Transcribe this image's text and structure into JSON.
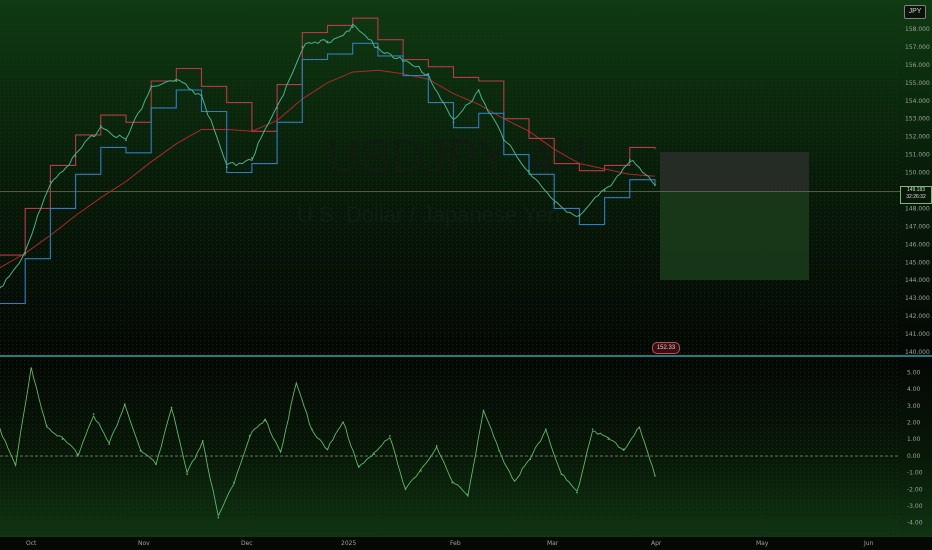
{
  "watermark": {
    "symbol": "USDJPY, 4H",
    "description": "U.S. Dollar / Japanese Yen"
  },
  "currency_badge": "JPY",
  "price_label": {
    "price": "149.183",
    "timer": "32:26:32"
  },
  "countdown_badge": "152.33",
  "colors": {
    "price": "#4fae8e",
    "resistance": "#b83a4a",
    "support": "#2f7ec0",
    "moving_average": "#a82a2a",
    "oscillator": "#63b569",
    "divider": "#2aa6a6",
    "profit_zone": "#1b3c1b",
    "risk_zone": "#2a2f2a"
  },
  "chart_data": [
    {
      "type": "line",
      "name": "price-pane",
      "yticks": [
        "158.000",
        "157.000",
        "156.000",
        "155.000",
        "154.000",
        "153.000",
        "152.000",
        "151.000",
        "150.000",
        "149.000",
        "148.000",
        "147.000",
        "146.000",
        "145.000",
        "144.000",
        "143.000",
        "142.000",
        "141.000",
        "140.000"
      ],
      "ylim": [
        140,
        158.5
      ],
      "xlabels": [
        "Oct",
        "Nov",
        "Dec",
        "2025",
        "Feb",
        "Mar",
        "Apr",
        "May",
        "Jun"
      ],
      "x": [
        "Oct 1",
        "Oct 8",
        "Oct 15",
        "Oct 22",
        "Oct 29",
        "Nov 5",
        "Nov 12",
        "Nov 19",
        "Nov 26",
        "Dec 3",
        "Dec 10",
        "Dec 17",
        "Dec 24",
        "Dec 31",
        "Jan 7",
        "Jan 14",
        "Jan 21",
        "Jan 28",
        "Feb 4",
        "Feb 11",
        "Feb 18",
        "Feb 25",
        "Mar 4",
        "Mar 11",
        "Mar 18",
        "Mar 25",
        "Apr 1"
      ],
      "series": [
        {
          "values": [
            143.6,
            145.5,
            149.5,
            150.9,
            152.6,
            151.8,
            154.8,
            155.1,
            154.3,
            150.3,
            150.8,
            153.6,
            157.0,
            157.3,
            158.1,
            157.0,
            156.2,
            155.5,
            152.8,
            154.6,
            151.8,
            150.1,
            148.3,
            147.6,
            149.0,
            150.7,
            149.3
          ]
        },
        {
          "values": [
            145.4,
            148.0,
            150.4,
            152.1,
            153.2,
            152.8,
            155.1,
            155.8,
            154.8,
            153.9,
            152.3,
            154.9,
            157.8,
            158.2,
            158.6,
            157.4,
            156.3,
            155.9,
            155.3,
            155.1,
            153.0,
            151.9,
            150.5,
            150.1,
            150.4,
            151.4,
            151.3
          ]
        },
        {
          "values": [
            142.7,
            145.2,
            148.0,
            149.9,
            151.4,
            151.1,
            153.6,
            154.6,
            153.4,
            150.0,
            150.5,
            152.8,
            156.3,
            156.6,
            157.2,
            156.5,
            155.4,
            153.9,
            152.5,
            153.3,
            151.0,
            149.9,
            148.0,
            147.1,
            148.6,
            149.6,
            149.3
          ]
        },
        {
          "values": [
            144.7,
            145.5,
            146.5,
            147.6,
            148.6,
            149.5,
            150.6,
            151.6,
            152.4,
            152.4,
            152.3,
            152.9,
            154.1,
            155.0,
            155.6,
            155.7,
            155.5,
            155.2,
            154.4,
            153.8,
            153.0,
            152.3,
            151.3,
            150.5,
            150.2,
            149.9,
            149.8
          ]
        }
      ]
    },
    {
      "type": "line",
      "name": "oscillator-pane",
      "yticks": [
        "5.00",
        "4.00",
        "3.00",
        "2.00",
        "1.00",
        "0.00",
        "-1.00",
        "-2.00",
        "-3.00",
        "-4.00"
      ],
      "ylim": [
        -4.5,
        5.5
      ],
      "series": [
        {
          "values": [
            1.6,
            -0.5,
            5.2,
            1.8,
            1.0,
            0.1,
            2.5,
            0.7,
            3.1,
            0.3,
            -0.5,
            2.9,
            -1.1,
            0.9,
            -3.7,
            -1.6,
            1.2,
            2.1,
            0.3,
            4.3,
            1.6,
            0.4,
            2.0,
            -0.6,
            0.1,
            1.2,
            -2.0,
            -0.9,
            0.6,
            -1.6,
            -2.3,
            2.7,
            0.3,
            -1.5,
            -0.2,
            1.6,
            -1.1,
            -2.2,
            1.6,
            1.0,
            0.4,
            1.7,
            -1.2
          ]
        }
      ],
      "zero_line": "dashed"
    }
  ]
}
